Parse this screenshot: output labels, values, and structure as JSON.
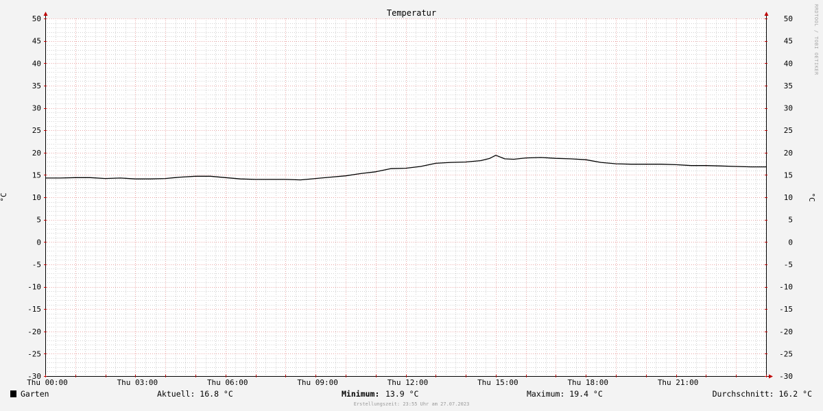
{
  "chart_data": {
    "type": "line",
    "title": "Temperatur",
    "ylabel": "°C",
    "ylim": [
      -30,
      50
    ],
    "yticks": [
      "50",
      "45",
      "40",
      "35",
      "30",
      "25",
      "20",
      "15",
      "10",
      "5",
      "0",
      "-5",
      "-10",
      "-15",
      "-20",
      "-25",
      "-30"
    ],
    "xlim": [
      0,
      24
    ],
    "xticks": [
      {
        "value": 0,
        "label": "Thu 00:00"
      },
      {
        "value": 3,
        "label": "Thu 03:00"
      },
      {
        "value": 6,
        "label": "Thu 06:00"
      },
      {
        "value": 9,
        "label": "Thu 09:00"
      },
      {
        "value": 12,
        "label": "Thu 12:00"
      },
      {
        "value": 15,
        "label": "Thu 15:00"
      },
      {
        "value": 18,
        "label": "Thu 18:00"
      },
      {
        "value": 21,
        "label": "Thu 21:00"
      }
    ],
    "grid": true,
    "series": [
      {
        "name": "Garten",
        "color": "#000000",
        "x": [
          0,
          0.5,
          1,
          1.5,
          2,
          2.5,
          3,
          3.5,
          4,
          4.5,
          5,
          5.5,
          6,
          6.5,
          7,
          7.5,
          8,
          8.5,
          9,
          9.5,
          10,
          10.5,
          11,
          11.5,
          12,
          12.5,
          13,
          13.5,
          14,
          14.5,
          14.8,
          15,
          15.3,
          15.6,
          16,
          16.5,
          17,
          17.5,
          18,
          18.5,
          19,
          19.5,
          20,
          20.5,
          21,
          21.5,
          22,
          22.5,
          23,
          23.5,
          24
        ],
        "y": [
          14.3,
          14.3,
          14.4,
          14.4,
          14.2,
          14.3,
          14.1,
          14.1,
          14.2,
          14.5,
          14.7,
          14.7,
          14.4,
          14.1,
          14.0,
          14.0,
          14.0,
          13.9,
          14.2,
          14.5,
          14.8,
          15.3,
          15.7,
          16.4,
          16.5,
          16.9,
          17.6,
          17.8,
          17.9,
          18.2,
          18.7,
          19.4,
          18.6,
          18.5,
          18.8,
          18.9,
          18.7,
          18.6,
          18.4,
          17.8,
          17.5,
          17.4,
          17.4,
          17.4,
          17.3,
          17.1,
          17.1,
          17.0,
          16.9,
          16.8,
          16.8
        ]
      }
    ]
  },
  "legend": {
    "series_name": "Garten",
    "current": "Aktuell: 16.8 °C",
    "minimum_label": "Minimum:",
    "minimum_value": "13.9 °C",
    "maximum": "Maximum: 19.4 °C",
    "average": "Durchschnitt: 16.2 °C"
  },
  "footer": "Erstellungszeit: 23:55 Uhr am 27.07.2023",
  "watermark": "RRDTOOL / TOBI OETIKER",
  "colors": {
    "background": "#f3f3f3",
    "canvas": "#ffffff",
    "major_grid": "#e8a0a0",
    "minor_grid": "#cfcfcf",
    "axis_arrow": "#c00000",
    "line": "#000000"
  }
}
